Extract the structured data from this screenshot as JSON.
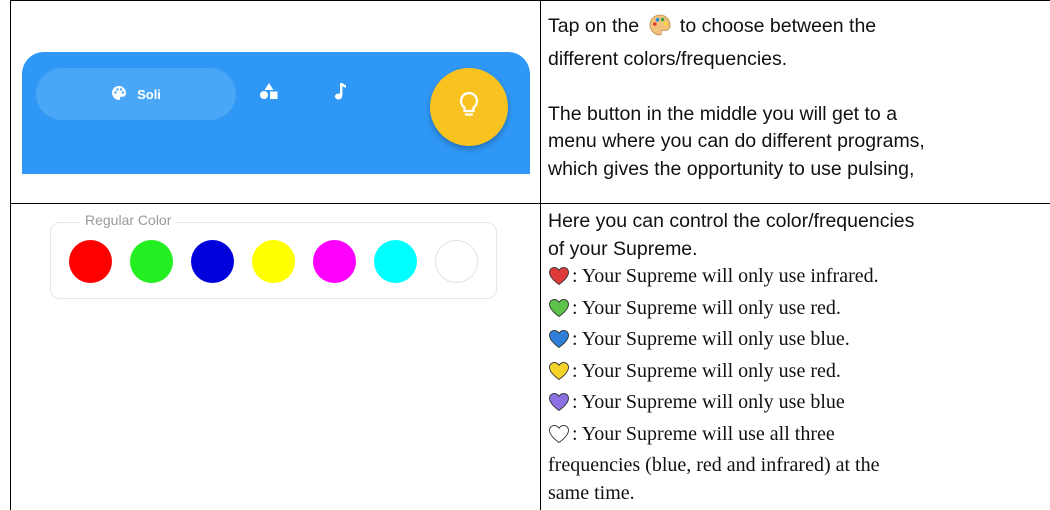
{
  "app_bar": {
    "soli_label": "Soli",
    "palette_icon": "palette-icon",
    "shapes_icon": "shapes-icon",
    "music_icon": "music-note-icon",
    "bulb_icon": "lightbulb-icon",
    "bar_color": "#2f97f5",
    "bulb_color": "#f8c220"
  },
  "color_picker": {
    "legend": "Regular Color",
    "swatches": [
      "#ff0000",
      "#22ee22",
      "#0000dd",
      "#ffff00",
      "#ff00ff",
      "#00ffff",
      "#ffffff"
    ]
  },
  "row1_text": {
    "line1a": "Tap on the",
    "line1b": "to choose between the",
    "line2": "different colors/frequencies.",
    "line3": "The button in the middle you will get to a",
    "line4": "menu where you can do different programs,",
    "line5": "which gives the opportunity to use pulsing,"
  },
  "row2_text": {
    "line1": "Here you can control the color/frequencies",
    "line2": "of your Supreme.",
    "items": [
      {
        "heart": "red-heart-icon",
        "color": "#e03a3a",
        "text": ": Your Supreme will only use infrared."
      },
      {
        "heart": "green-heart-icon",
        "color": "#5cc24a",
        "text": ": Your Supreme will only use red."
      },
      {
        "heart": "blue-heart-icon",
        "color": "#2f7fd8",
        "text": ": Your Supreme will only use blue."
      },
      {
        "heart": "yellow-heart-icon",
        "color": "#f5d32b",
        "text": ": Your Supreme will only use red."
      },
      {
        "heart": "purple-heart-icon",
        "color": "#8c6fe0",
        "text": ": Your Supreme will only use blue"
      },
      {
        "heart": "white-heart-icon",
        "color": "#ffffff",
        "text": ": Your Supreme will use all three"
      }
    ],
    "cont1": "frequencies (blue, red and infrared) at the",
    "cont2": "same time."
  }
}
